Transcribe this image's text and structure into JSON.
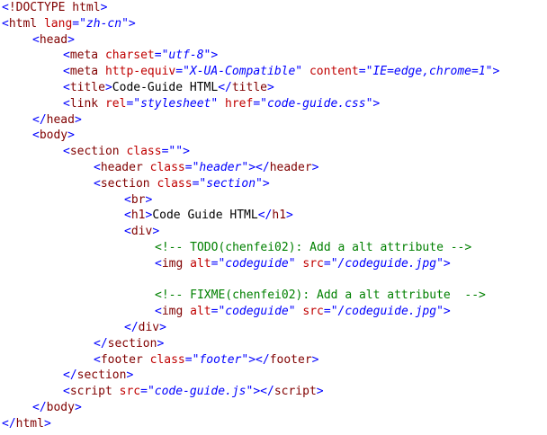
{
  "editor": {
    "background": "#ffffff",
    "colors": {
      "tag": "#800000",
      "attribute": "#c00000",
      "string": "#0000ff",
      "text": "#000000",
      "comment": "#008000",
      "punct": "#0000ff"
    },
    "lines": [
      {
        "indent": 0,
        "tokens": [
          {
            "t": "punct",
            "v": "<"
          },
          {
            "t": "doctype",
            "v": "!DOCTYPE html"
          },
          {
            "t": "punct",
            "v": ">"
          }
        ]
      },
      {
        "indent": 0,
        "tokens": [
          {
            "t": "punct",
            "v": "<"
          },
          {
            "t": "tag",
            "v": "html"
          },
          {
            "t": "text",
            "v": " "
          },
          {
            "t": "attr",
            "v": "lang"
          },
          {
            "t": "punct",
            "v": "="
          },
          {
            "t": "str",
            "v": "\"zh-cn\""
          },
          {
            "t": "punct",
            "v": ">"
          }
        ]
      },
      {
        "indent": 1,
        "tokens": [
          {
            "t": "punct",
            "v": "<"
          },
          {
            "t": "tag",
            "v": "head"
          },
          {
            "t": "punct",
            "v": ">"
          }
        ]
      },
      {
        "indent": 2,
        "tokens": [
          {
            "t": "punct",
            "v": "<"
          },
          {
            "t": "tag",
            "v": "meta"
          },
          {
            "t": "text",
            "v": " "
          },
          {
            "t": "attr",
            "v": "charset"
          },
          {
            "t": "punct",
            "v": "="
          },
          {
            "t": "str",
            "v": "\"utf-8\""
          },
          {
            "t": "punct",
            "v": ">"
          }
        ]
      },
      {
        "indent": 2,
        "tokens": [
          {
            "t": "punct",
            "v": "<"
          },
          {
            "t": "tag",
            "v": "meta"
          },
          {
            "t": "text",
            "v": " "
          },
          {
            "t": "attr",
            "v": "http-equiv"
          },
          {
            "t": "punct",
            "v": "="
          },
          {
            "t": "str",
            "v": "\"X-UA-Compatible\""
          },
          {
            "t": "text",
            "v": " "
          },
          {
            "t": "attr",
            "v": "content"
          },
          {
            "t": "punct",
            "v": "="
          },
          {
            "t": "str",
            "v": "\"IE=edge,chrome=1\""
          },
          {
            "t": "punct",
            "v": ">"
          }
        ]
      },
      {
        "indent": 2,
        "tokens": [
          {
            "t": "punct",
            "v": "<"
          },
          {
            "t": "tag",
            "v": "title"
          },
          {
            "t": "punct",
            "v": ">"
          },
          {
            "t": "text",
            "v": "Code-Guide HTML"
          },
          {
            "t": "punct",
            "v": "</"
          },
          {
            "t": "tag",
            "v": "title"
          },
          {
            "t": "punct",
            "v": ">"
          }
        ]
      },
      {
        "indent": 2,
        "tokens": [
          {
            "t": "punct",
            "v": "<"
          },
          {
            "t": "tag",
            "v": "link"
          },
          {
            "t": "text",
            "v": " "
          },
          {
            "t": "attr",
            "v": "rel"
          },
          {
            "t": "punct",
            "v": "="
          },
          {
            "t": "str",
            "v": "\"stylesheet\""
          },
          {
            "t": "text",
            "v": " "
          },
          {
            "t": "attr",
            "v": "href"
          },
          {
            "t": "punct",
            "v": "="
          },
          {
            "t": "str",
            "v": "\"code-guide.css\""
          },
          {
            "t": "punct",
            "v": ">"
          }
        ]
      },
      {
        "indent": 1,
        "tokens": [
          {
            "t": "punct",
            "v": "</"
          },
          {
            "t": "tag",
            "v": "head"
          },
          {
            "t": "punct",
            "v": ">"
          }
        ]
      },
      {
        "indent": 1,
        "tokens": [
          {
            "t": "punct",
            "v": "<"
          },
          {
            "t": "tag",
            "v": "body"
          },
          {
            "t": "punct",
            "v": ">"
          }
        ]
      },
      {
        "indent": 2,
        "tokens": [
          {
            "t": "punct",
            "v": "<"
          },
          {
            "t": "tag",
            "v": "section"
          },
          {
            "t": "text",
            "v": " "
          },
          {
            "t": "attr",
            "v": "class"
          },
          {
            "t": "punct",
            "v": "="
          },
          {
            "t": "str",
            "v": "\"\""
          },
          {
            "t": "punct",
            "v": ">"
          }
        ]
      },
      {
        "indent": 3,
        "tokens": [
          {
            "t": "punct",
            "v": "<"
          },
          {
            "t": "tag",
            "v": "header"
          },
          {
            "t": "text",
            "v": " "
          },
          {
            "t": "attr",
            "v": "class"
          },
          {
            "t": "punct",
            "v": "="
          },
          {
            "t": "str",
            "v": "\"header\""
          },
          {
            "t": "punct",
            "v": "></"
          },
          {
            "t": "tag",
            "v": "header"
          },
          {
            "t": "punct",
            "v": ">"
          }
        ]
      },
      {
        "indent": 3,
        "tokens": [
          {
            "t": "punct",
            "v": "<"
          },
          {
            "t": "tag",
            "v": "section"
          },
          {
            "t": "text",
            "v": " "
          },
          {
            "t": "attr",
            "v": "class"
          },
          {
            "t": "punct",
            "v": "="
          },
          {
            "t": "str",
            "v": "\"section\""
          },
          {
            "t": "punct",
            "v": ">"
          }
        ]
      },
      {
        "indent": 4,
        "tokens": [
          {
            "t": "punct",
            "v": "<"
          },
          {
            "t": "tag",
            "v": "br"
          },
          {
            "t": "punct",
            "v": ">"
          }
        ]
      },
      {
        "indent": 4,
        "tokens": [
          {
            "t": "punct",
            "v": "<"
          },
          {
            "t": "tag",
            "v": "h1"
          },
          {
            "t": "punct",
            "v": ">"
          },
          {
            "t": "text",
            "v": "Code Guide HTML"
          },
          {
            "t": "punct",
            "v": "</"
          },
          {
            "t": "tag",
            "v": "h1"
          },
          {
            "t": "punct",
            "v": ">"
          }
        ]
      },
      {
        "indent": 4,
        "tokens": [
          {
            "t": "punct",
            "v": "<"
          },
          {
            "t": "tag",
            "v": "div"
          },
          {
            "t": "punct",
            "v": ">"
          }
        ]
      },
      {
        "indent": 5,
        "tokens": [
          {
            "t": "comment",
            "v": "<!-- TODO(chenfei02): Add a alt attribute -->"
          }
        ]
      },
      {
        "indent": 5,
        "tokens": [
          {
            "t": "punct",
            "v": "<"
          },
          {
            "t": "tag",
            "v": "img"
          },
          {
            "t": "text",
            "v": " "
          },
          {
            "t": "attr",
            "v": "alt"
          },
          {
            "t": "punct",
            "v": "="
          },
          {
            "t": "str",
            "v": "\"codeguide\""
          },
          {
            "t": "text",
            "v": " "
          },
          {
            "t": "attr",
            "v": "src"
          },
          {
            "t": "punct",
            "v": "="
          },
          {
            "t": "str",
            "v": "\"/codeguide.jpg\""
          },
          {
            "t": "punct",
            "v": ">"
          }
        ]
      },
      {
        "indent": 0,
        "tokens": []
      },
      {
        "indent": 5,
        "tokens": [
          {
            "t": "comment",
            "v": "<!-- FIXME(chenfei02): Add a alt attribute  -->"
          }
        ]
      },
      {
        "indent": 5,
        "tokens": [
          {
            "t": "punct",
            "v": "<"
          },
          {
            "t": "tag",
            "v": "img"
          },
          {
            "t": "text",
            "v": " "
          },
          {
            "t": "attr",
            "v": "alt"
          },
          {
            "t": "punct",
            "v": "="
          },
          {
            "t": "str",
            "v": "\"codeguide\""
          },
          {
            "t": "text",
            "v": " "
          },
          {
            "t": "attr",
            "v": "src"
          },
          {
            "t": "punct",
            "v": "="
          },
          {
            "t": "str",
            "v": "\"/codeguide.jpg\""
          },
          {
            "t": "punct",
            "v": ">"
          }
        ]
      },
      {
        "indent": 4,
        "tokens": [
          {
            "t": "punct",
            "v": "</"
          },
          {
            "t": "tag",
            "v": "div"
          },
          {
            "t": "punct",
            "v": ">"
          }
        ]
      },
      {
        "indent": 3,
        "tokens": [
          {
            "t": "punct",
            "v": "</"
          },
          {
            "t": "tag",
            "v": "section"
          },
          {
            "t": "punct",
            "v": ">"
          }
        ]
      },
      {
        "indent": 3,
        "tokens": [
          {
            "t": "punct",
            "v": "<"
          },
          {
            "t": "tag",
            "v": "footer"
          },
          {
            "t": "text",
            "v": " "
          },
          {
            "t": "attr",
            "v": "class"
          },
          {
            "t": "punct",
            "v": "="
          },
          {
            "t": "str",
            "v": "\"footer\""
          },
          {
            "t": "punct",
            "v": "></"
          },
          {
            "t": "tag",
            "v": "footer"
          },
          {
            "t": "punct",
            "v": ">"
          }
        ]
      },
      {
        "indent": 2,
        "tokens": [
          {
            "t": "punct",
            "v": "</"
          },
          {
            "t": "tag",
            "v": "section"
          },
          {
            "t": "punct",
            "v": ">"
          }
        ]
      },
      {
        "indent": 2,
        "tokens": [
          {
            "t": "punct",
            "v": "<"
          },
          {
            "t": "tag",
            "v": "script"
          },
          {
            "t": "text",
            "v": " "
          },
          {
            "t": "attr",
            "v": "src"
          },
          {
            "t": "punct",
            "v": "="
          },
          {
            "t": "str",
            "v": "\"code-guide.js\""
          },
          {
            "t": "punct",
            "v": "></"
          },
          {
            "t": "tag",
            "v": "script"
          },
          {
            "t": "punct",
            "v": ">"
          }
        ]
      },
      {
        "indent": 1,
        "tokens": [
          {
            "t": "punct",
            "v": "</"
          },
          {
            "t": "tag",
            "v": "body"
          },
          {
            "t": "punct",
            "v": ">"
          }
        ]
      },
      {
        "indent": 0,
        "tokens": [
          {
            "t": "punct",
            "v": "</"
          },
          {
            "t": "tag",
            "v": "html"
          },
          {
            "t": "punct",
            "v": ">"
          }
        ]
      }
    ]
  }
}
